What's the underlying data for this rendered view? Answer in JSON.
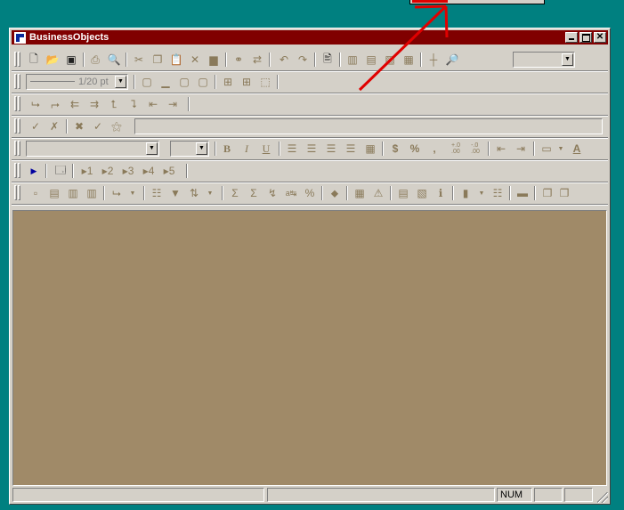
{
  "window": {
    "title": "BusinessObjects"
  },
  "toolbar_font": {
    "line_width": "1/20 pt",
    "section_labels": [
      "1",
      "2",
      "3",
      "4",
      "5"
    ]
  },
  "format": {
    "bold_label": "B",
    "italic_label": "I",
    "underline_label": "U",
    "currency_label": "$",
    "percent_label": "%",
    "thousands_label": ",",
    "dec_add_label": "+.0\n.00",
    "dec_remove_label": "-.0\n.00",
    "fontcolor_label": "A"
  },
  "status": {
    "num_label": "NUM"
  },
  "colors": {
    "desktop": "#008080",
    "titlebar": "#800000",
    "workspace": "#a08a68",
    "arrow": "#e00000"
  },
  "icons": [
    "new-icon",
    "open-icon",
    "save-icon",
    "print-icon",
    "print-preview-icon",
    "cut-icon",
    "copy-icon",
    "paste-icon",
    "delete-icon",
    "clear-icon",
    "find-icon",
    "replace-icon",
    "undo-icon",
    "redo-icon",
    "report-icon",
    "zoom-icon"
  ]
}
